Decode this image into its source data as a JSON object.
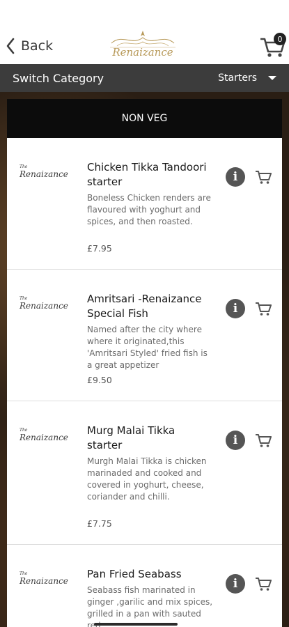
{
  "header": {
    "back_label": "Back",
    "logo_text": "Renaizance",
    "cart_count": "0"
  },
  "category_bar": {
    "label": "Switch Category",
    "selected": "Starters"
  },
  "section": {
    "title": "NON VEG"
  },
  "item_logo": {
    "the": "The",
    "name": "Renaizance"
  },
  "items": [
    {
      "title": "Chicken Tikka Tandoori starter",
      "description": "Boneless Chicken renders are flavoured with yoghurt and spices, and then roasted.",
      "price": "£7.95"
    },
    {
      "title": "Amritsari -Renaizance Special Fish",
      "description": "Named after the city where where it originated,this 'Amritsari Styled' fried fish is a great appetizer",
      "price": "£9.50"
    },
    {
      "title": "Murg Malai Tikka starter",
      "description": "Murgh Malai Tikka is chicken marinaded and cooked and covered in yoghurt, cheese, coriander and chilli.",
      "price": "£7.75"
    },
    {
      "title": "Pan Fried Seabass",
      "description": "Seabass fish marinated in ginger ,garilic and mix spices, grilled in a pan with sauted red",
      "price": ""
    }
  ],
  "colors": {
    "bar": "#3c3c3c",
    "section_header": "#0c0c0c",
    "logo_gold": "#b89a5a",
    "icon_gray": "#555555"
  }
}
